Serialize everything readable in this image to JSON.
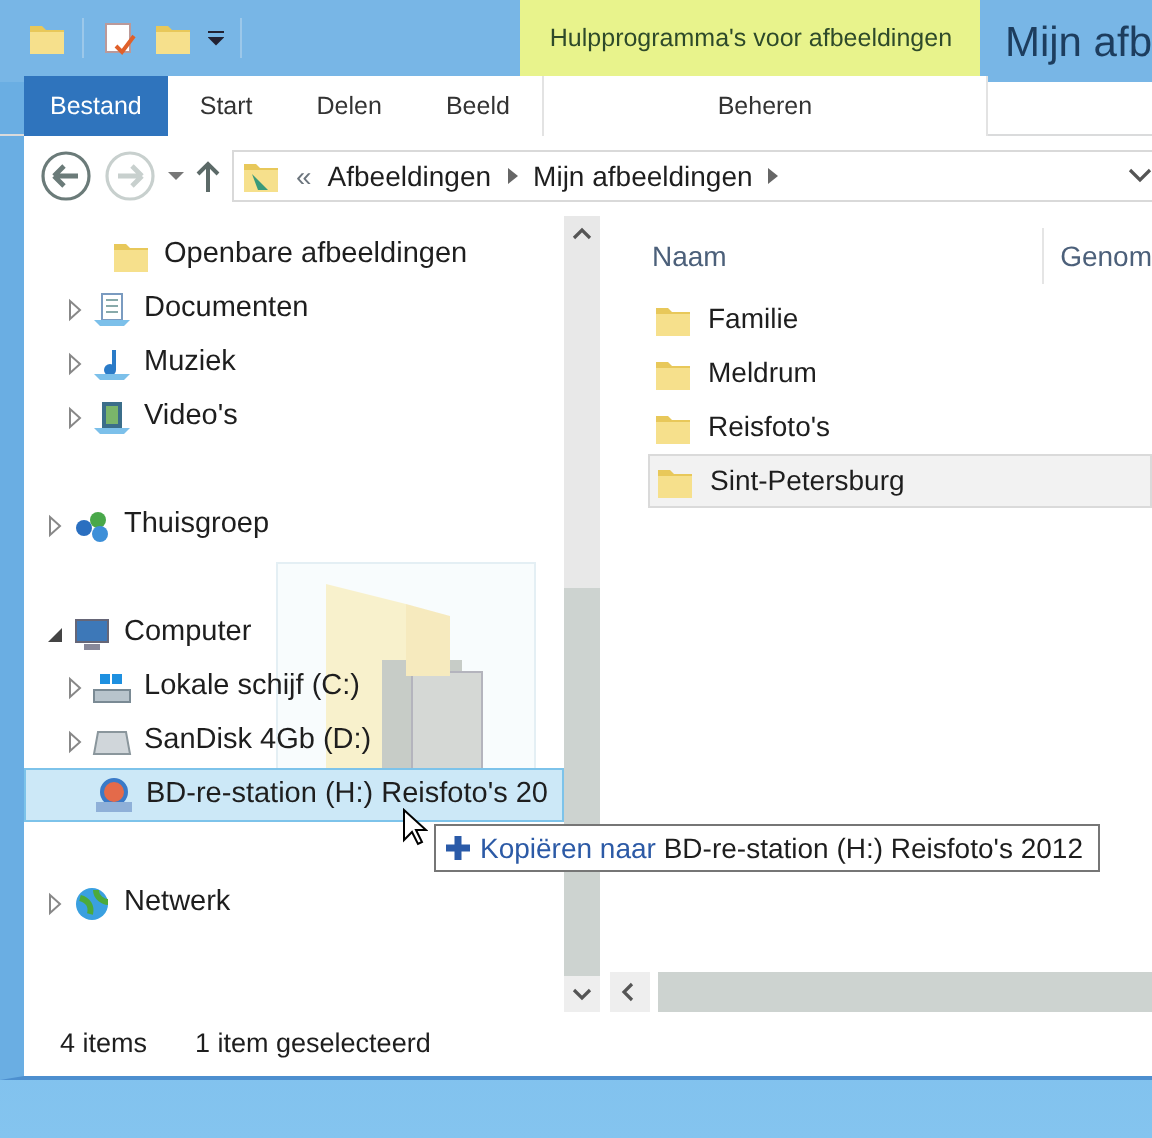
{
  "window": {
    "title": "Mijn afb"
  },
  "contextual_group": {
    "label": "Hulpprogramma's voor afbeeldingen"
  },
  "ribbon_tabs": [
    {
      "label": "Bestand",
      "kind": "file",
      "selected": false
    },
    {
      "label": "Start",
      "kind": "tab",
      "selected": false
    },
    {
      "label": "Delen",
      "kind": "tab",
      "selected": false
    },
    {
      "label": "Beeld",
      "kind": "tab",
      "selected": false
    },
    {
      "label": "Beheren",
      "kind": "context",
      "selected": false
    }
  ],
  "navigation": {
    "separator": "«",
    "path": [
      "Afbeeldingen",
      "Mijn afbeeldingen"
    ]
  },
  "nav_tree": [
    {
      "children": [
        {
          "children": [
            {
              "label": "Openbare afbeeldingen",
              "selected": false
            }
          ]
        },
        {
          "label": "Documenten",
          "expanded": false,
          "selected": false
        },
        {
          "label": "Muziek",
          "expanded": false,
          "selected": false
        },
        {
          "label": "Video's",
          "expanded": false,
          "selected": false
        }
      ]
    },
    {
      "label": "Thuisgroep",
      "expanded": false,
      "selected": false
    },
    {
      "label": "Computer",
      "expanded": true,
      "selected": false,
      "children": [
        {
          "label": "Lokale schijf (C:)",
          "expanded": false,
          "selected": false
        },
        {
          "label": "SanDisk 4Gb (D:)",
          "expanded": false,
          "selected": false
        },
        {
          "label": "BD-re-station (H:) Reisfoto's 20",
          "selected": true
        }
      ]
    },
    {
      "label": "Netwerk",
      "expanded": false,
      "selected": false
    }
  ],
  "columns": [
    "Naam",
    "Genom"
  ],
  "files": [
    {
      "name": "Familie",
      "selected": false
    },
    {
      "name": "Meldrum",
      "selected": false
    },
    {
      "name": "Reisfoto's",
      "selected": false
    },
    {
      "name": "Sint-Petersburg",
      "selected": true
    }
  ],
  "drop_tooltip": {
    "action": "Kopiëren naar",
    "target": "BD-re-station (H:) Reisfoto's 2012"
  },
  "status_bar": {
    "count": "4 items",
    "selection": "1 item geselecteerd"
  }
}
